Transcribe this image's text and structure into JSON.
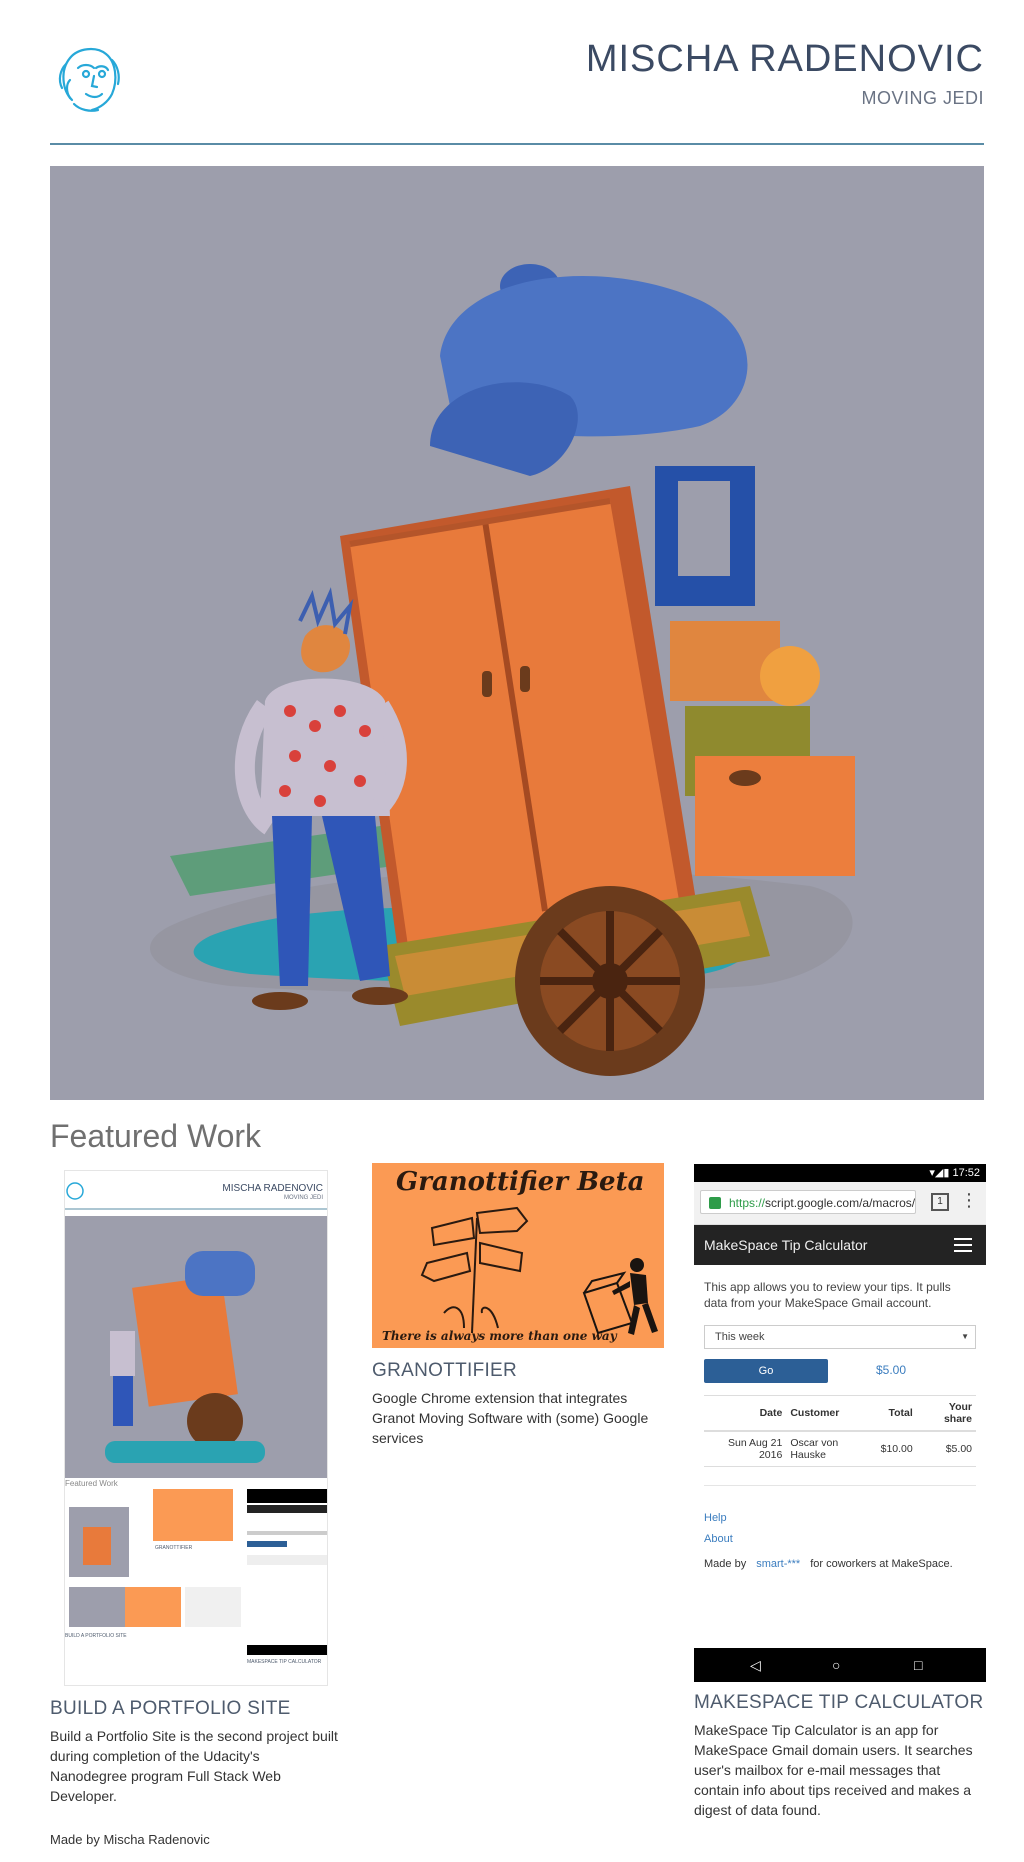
{
  "header": {
    "site_name": "MISCHA RADENOVIC",
    "subtitle": "MOVING JEDI"
  },
  "featured": {
    "title": "Featured Work"
  },
  "projects": [
    {
      "title": "BUILD A PORTFOLIO SITE",
      "description": "Build a Portfolio Site is the second project built during completion of the Udacity's Nanodegree program Full Stack Web Developer."
    },
    {
      "title": "GRANOTTIFIER",
      "description": "Google Chrome extension that integrates Granot Moving Software with (some) Google services"
    },
    {
      "title": "MAKESPACE TIP CALCULATOR",
      "description": "MakeSpace Tip Calculator is an app for MakeSpace Gmail domain users. It searches user's mailbox for e-mail messages that contain info about tips received and makes a digest of data found."
    }
  ],
  "mini_portfolio": {
    "site_name": "MISCHA RADENOVIC",
    "subtitle": "MOVING JEDI",
    "featured": "Featured Work",
    "project_label": "BUILD A PORTFOLIO SITE",
    "gran_label": "GRANOTTIFIER",
    "tip_label": "MAKESPACE TIP CALCULATOR"
  },
  "granottifier_image": {
    "title": "Granottifier Beta",
    "tagline": "There is always more than one way"
  },
  "phone": {
    "time": "17:52",
    "url_https": "https://",
    "url_rest": "script.google.com/a/macros/",
    "tab_count": "1",
    "app_title": "MakeSpace Tip Calculator",
    "intro": "This app allows you to review your tips. It pulls data from your MakeSpace Gmail account.",
    "period": "This week",
    "go": "Go",
    "amount": "$5.00",
    "table_headers": [
      "Date",
      "Customer",
      "Total",
      "Your share"
    ],
    "rows": [
      [
        "Sun Aug 21 2016",
        "Oscar von Hauske",
        "$10.00",
        "$5.00"
      ]
    ],
    "help": "Help",
    "about": "About",
    "made_by_prefix": "Made by",
    "made_by_link": "smart-***",
    "made_by_suffix": "for coworkers at MakeSpace."
  },
  "footer": {
    "text": "Made by Mischa Radenovic"
  },
  "colors": {
    "title": "#3b4a63",
    "rule": "#5a8ca6",
    "hero_bg": "#9d9eac",
    "cabinet": "#e87a3b",
    "granottifier_bg": "#fb9a54",
    "logo": "#27a8d8"
  }
}
